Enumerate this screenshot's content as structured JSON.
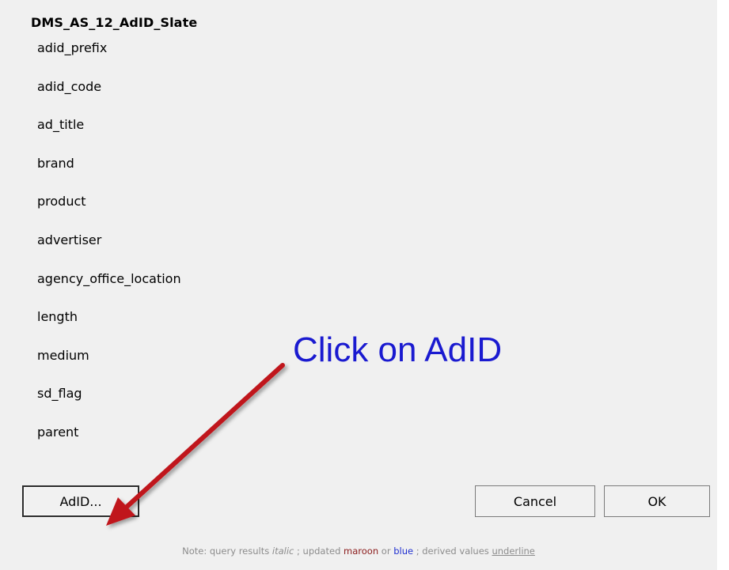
{
  "dialog": {
    "title": "DMS_AS_12_AdID_Slate",
    "fields": [
      "adid_prefix",
      "adid_code",
      "ad_title",
      "brand",
      "product",
      "advertiser",
      "agency_office_location",
      "length",
      "medium",
      "sd_flag",
      "parent"
    ],
    "buttons": {
      "adid": "AdID...",
      "cancel": "Cancel",
      "ok": "OK"
    },
    "note": {
      "prefix": "Note: query results ",
      "italic_word": "italic",
      "part2": " ; updated ",
      "maroon_word": "maroon",
      "part3": " or ",
      "blue_word": "blue",
      "part4": " ; derived values ",
      "underline_word": "underline"
    }
  },
  "annotation": {
    "callout_text": "Click on AdID",
    "arrow_color": "#c0161c",
    "text_color": "#1a1ad0"
  },
  "colors": {
    "background": "#f0f0f0",
    "maroon": "#8b1c1c",
    "blue": "#1f2fd0"
  }
}
